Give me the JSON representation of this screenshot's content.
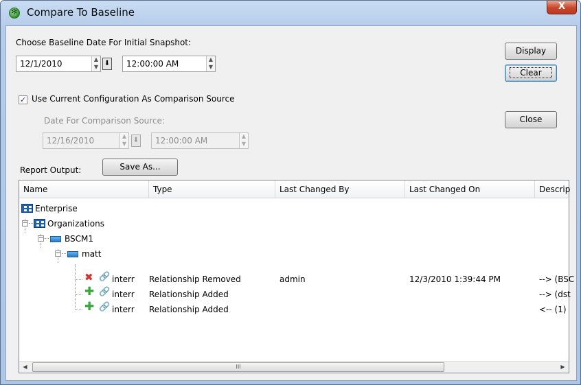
{
  "window": {
    "title": "Compare To Baseline",
    "close_glyph": "X"
  },
  "baseline": {
    "label": "Choose Baseline Date For Initial Snapshot:",
    "date": "12/1/2010",
    "time": "12:00:00 AM"
  },
  "comparison": {
    "checkbox_label": "Use Current Configuration As Comparison Source",
    "checked": true,
    "date_label": "Date For Comparison Source:",
    "date": "12/16/2010",
    "time": "12:00:00 AM"
  },
  "buttons": {
    "display": "Display",
    "clear": "Clear",
    "close": "Close",
    "save_as": "Save As..."
  },
  "report": {
    "label": "Report Output:",
    "columns": [
      "Name",
      "Type",
      "Last Changed By",
      "Last Changed On",
      "Descrip"
    ],
    "tree": {
      "enterprise": "Enterprise",
      "organizations": "Organizations",
      "bscm1": "BSCM1",
      "matt": "matt"
    },
    "rows": [
      {
        "status": "removed",
        "name": "interr",
        "type": "Relationship Removed",
        "by": "admin",
        "on": "12/3/2010 1:39:44 PM",
        "desc": "--> (BSC"
      },
      {
        "status": "added",
        "name": "interr",
        "type": "Relationship Added",
        "by": "",
        "on": "",
        "desc": "--> (dst"
      },
      {
        "status": "added",
        "name": "interr",
        "type": "Relationship Added",
        "by": "",
        "on": "",
        "desc": "<-- (1)"
      }
    ],
    "scroll_grip": "III"
  },
  "icons": {
    "app": "green-gear-icon",
    "removed": "red-x-icon",
    "added": "green-plus-icon",
    "relationship": "link-icon",
    "enterprise": "enterprise-icon",
    "node": "monitor-icon"
  },
  "colors": {
    "title_bar": "#b4cbe9",
    "close_button": "#c8452b",
    "removed": "#d9302c",
    "added": "#3aa53a"
  }
}
